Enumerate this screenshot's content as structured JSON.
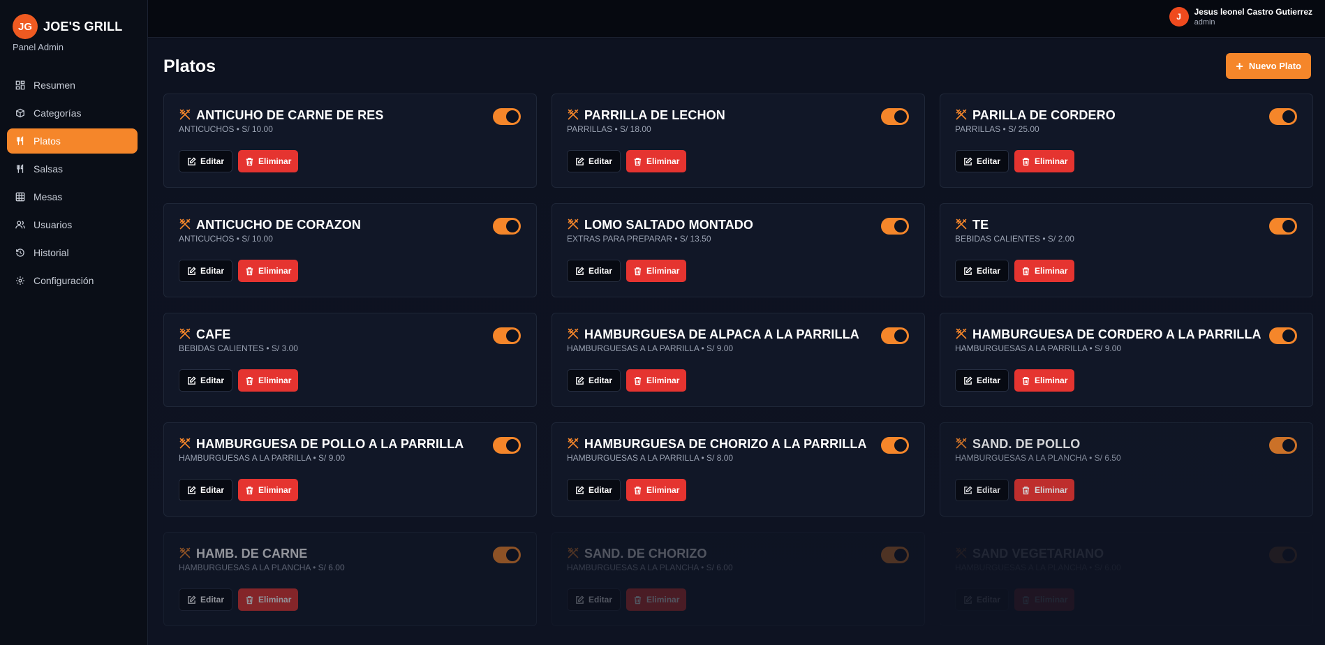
{
  "brand": {
    "initials": "JG",
    "name": "JOE'S GRILL",
    "subtitle": "Panel Admin"
  },
  "nav": [
    {
      "label": "Resumen",
      "icon": "dashboard-icon",
      "active": false
    },
    {
      "label": "Categorías",
      "icon": "box-icon",
      "active": false
    },
    {
      "label": "Platos",
      "icon": "utensils-icon",
      "active": true
    },
    {
      "label": "Salsas",
      "icon": "utensils-icon",
      "active": false
    },
    {
      "label": "Mesas",
      "icon": "table-icon",
      "active": false
    },
    {
      "label": "Usuarios",
      "icon": "users-icon",
      "active": false
    },
    {
      "label": "Historial",
      "icon": "history-icon",
      "active": false
    },
    {
      "label": "Configuración",
      "icon": "gear-icon",
      "active": false
    }
  ],
  "user": {
    "initial": "J",
    "name": "Jesus leonel Castro Gutierrez",
    "role": "admin"
  },
  "page": {
    "title": "Platos",
    "new_button": "Nuevo Plato"
  },
  "labels": {
    "edit": "Editar",
    "delete": "Eliminar"
  },
  "dishes": [
    {
      "name": "ANTICUHO DE CARNE DE RES",
      "meta": "ANTICUCHOS • S/ 10.00",
      "enabled": true
    },
    {
      "name": "PARRILLA DE LECHON",
      "meta": "PARRILLAS • S/ 18.00",
      "enabled": true
    },
    {
      "name": "PARILLA DE CORDERO",
      "meta": "PARRILLAS • S/ 25.00",
      "enabled": true
    },
    {
      "name": "ANTICUCHO DE CORAZON",
      "meta": "ANTICUCHOS • S/ 10.00",
      "enabled": true
    },
    {
      "name": "LOMO SALTADO MONTADO",
      "meta": "EXTRAS PARA PREPARAR • S/ 13.50",
      "enabled": true
    },
    {
      "name": "TE",
      "meta": "BEBIDAS CALIENTES • S/ 2.00",
      "enabled": true
    },
    {
      "name": "CAFE",
      "meta": "BEBIDAS CALIENTES • S/ 3.00",
      "enabled": true
    },
    {
      "name": "HAMBURGUESA DE ALPACA A LA PARRILLA",
      "meta": "HAMBURGUESAS A LA PARRILLA • S/ 9.00",
      "enabled": true
    },
    {
      "name": "HAMBURGUESA DE CORDERO A LA PARRILLA",
      "meta": "HAMBURGUESAS A LA PARRILLA • S/ 9.00",
      "enabled": true
    },
    {
      "name": "HAMBURGUESA DE POLLO A LA PARRILLA",
      "meta": "HAMBURGUESAS A LA PARRILLA • S/ 9.00",
      "enabled": true
    },
    {
      "name": "HAMBURGUESA DE CHORIZO A LA PARRILLA",
      "meta": "HAMBURGUESAS A LA PARRILLA • S/ 8.00",
      "enabled": true
    },
    {
      "name": "SAND. DE POLLO",
      "meta": "HAMBURGUESAS A LA PLANCHA • S/ 6.50",
      "enabled": true
    },
    {
      "name": "HAMB. DE CARNE",
      "meta": "HAMBURGUESAS A LA PLANCHA • S/ 6.00",
      "enabled": true
    },
    {
      "name": "SAND. DE CHORIZO",
      "meta": "HAMBURGUESAS A LA PLANCHA • S/ 6.00",
      "enabled": true
    },
    {
      "name": "SAND VEGETARIANO",
      "meta": "HAMBURGUESAS A LA PLANCHA • S/ 6.00",
      "enabled": true
    }
  ],
  "colors": {
    "accent": "#f5862a",
    "danger": "#e53430",
    "background": "#0b0f19"
  }
}
